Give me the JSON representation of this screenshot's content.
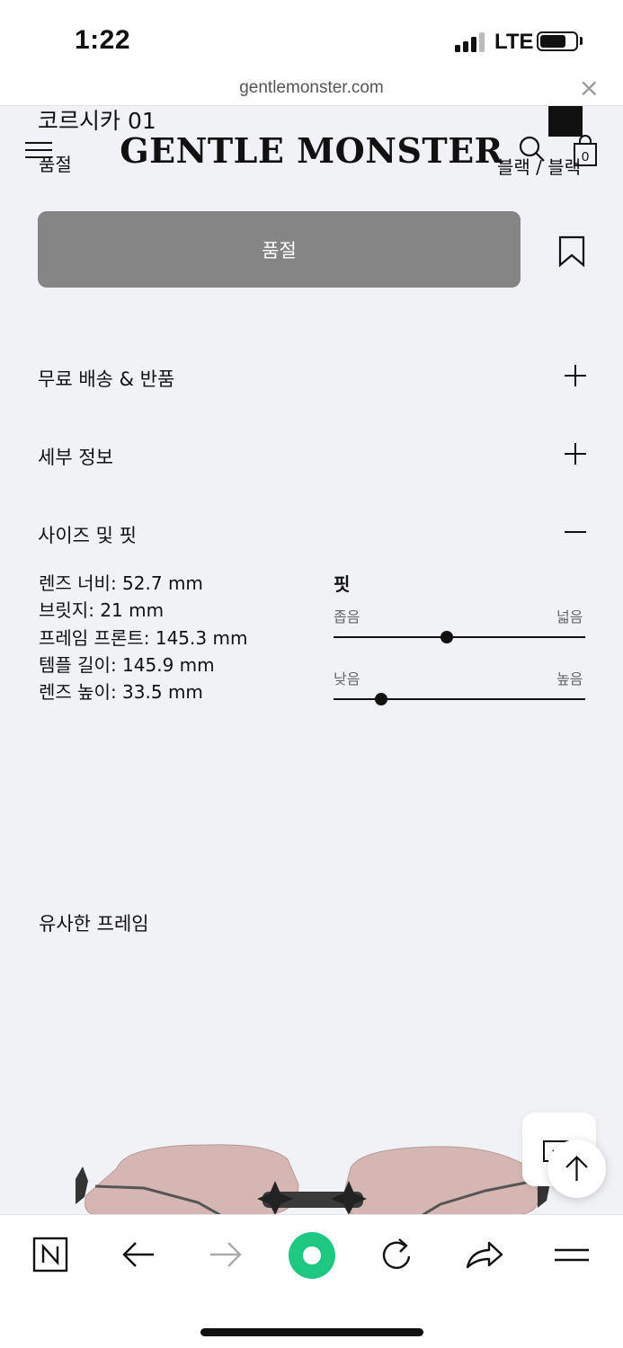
{
  "status_bar": {
    "time": "1:22",
    "network": "LTE",
    "signal_bars": 4,
    "signal_bars_active": 3,
    "battery_level": 0.65
  },
  "url_bar": {
    "url": "gentlemonster.com",
    "close_icon": "×"
  },
  "header": {
    "brand": "GENTLE MONSTER",
    "menu_icon": "hamburger-icon",
    "search_icon": "search-icon",
    "bag_icon": "shopping-bag-icon",
    "bag_count": "0"
  },
  "product": {
    "name": "코르시카 01",
    "status_text": "품절",
    "color_name": "블랙 / 블랙",
    "swatch_color": "#111111"
  },
  "actions": {
    "soldout_button": "품절",
    "bookmark_icon": "bookmark-icon"
  },
  "accordion": [
    {
      "label": "무료 배송 & 반품",
      "state": "collapsed",
      "icon": "plus-icon"
    },
    {
      "label": "세부 정보",
      "state": "collapsed",
      "icon": "plus-icon"
    },
    {
      "label": "사이즈 및 핏",
      "state": "expanded",
      "icon": "minus-icon"
    }
  ],
  "sizes": [
    "렌즈 너비: 52.7 mm",
    "브릿지: 21 mm",
    "프레임 프론트: 145.3 mm",
    "템플 길이: 145.9 mm",
    "렌즈 높이: 33.5 mm"
  ],
  "fit": {
    "title": "핏",
    "sliders": [
      {
        "min_label": "좁음",
        "max_label": "넓음",
        "value": 0.45
      },
      {
        "min_label": "낮음",
        "max_label": "높음",
        "value": 0.19
      }
    ]
  },
  "similar_frames": {
    "title": "유사한 프레임"
  },
  "floating": {
    "chat_icon": "chat-icon",
    "top_icon": "arrow-up-icon"
  },
  "toolbar": {
    "items": [
      "naver-icon",
      "back-arrow-icon",
      "forward-arrow-icon",
      "green-dot-icon",
      "refresh-icon",
      "share-icon",
      "menu-icon"
    ]
  },
  "colors": {
    "background": "#f1f2f5",
    "button_disabled": "#858585",
    "accent_green": "#1ec800"
  }
}
